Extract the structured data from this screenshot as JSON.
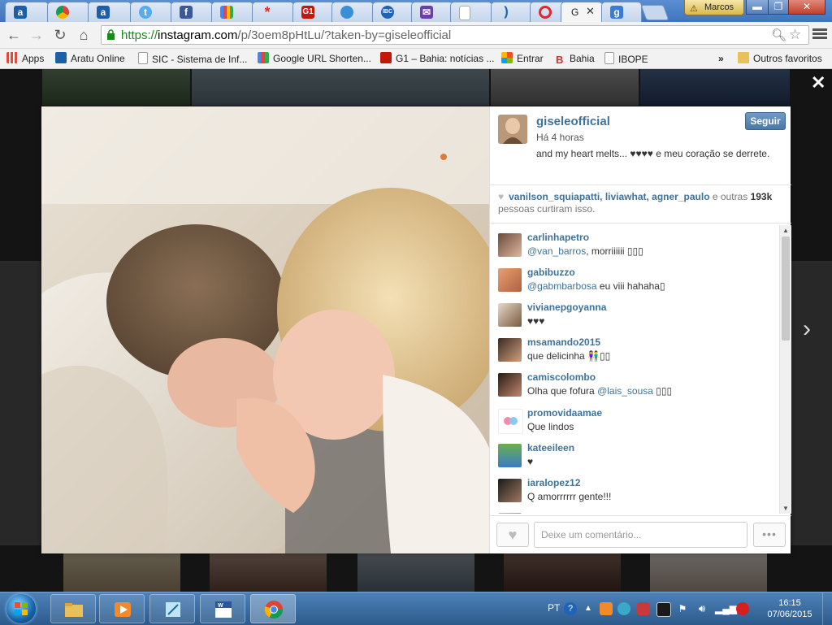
{
  "browser": {
    "active_tab_label": "G",
    "user_name": "Marcos",
    "url": {
      "scheme": "https://",
      "host": "instagram.com",
      "path": "/p/3oem8pHtLu/?taken-by=giseleofficial"
    }
  },
  "bookmarks": [
    {
      "label": "Apps",
      "icon": "apps-grid-icon",
      "color": "#e04c3c"
    },
    {
      "label": "Aratu Online",
      "icon": "aratu-icon",
      "color": "#1e5ea8"
    },
    {
      "label": "SIC - Sistema de Inf...",
      "icon": "page-icon",
      "color": "#ffffff"
    },
    {
      "label": "Google URL Shorten...",
      "icon": "google-icon",
      "color": "#3a7bd5"
    },
    {
      "label": "G1 – Bahia: notícias ...",
      "icon": "g1-icon",
      "color": "#c4170c"
    },
    {
      "label": "Entrar",
      "icon": "windows-logo-icon",
      "color": "#f25022"
    },
    {
      "label": "Bahia",
      "icon": "bahia-icon",
      "color": "#d32f2f"
    },
    {
      "label": "IBOPE",
      "icon": "page-icon",
      "color": "#ffffff"
    }
  ],
  "bookmarks_overflow": "»",
  "bookmarks_folder": "Outros favoritos",
  "post": {
    "username": "giseleofficial",
    "follow_label": "Seguir",
    "time": "Há 4 horas",
    "caption": "and my heart melts... ♥♥♥♥ e meu coração se derrete.",
    "likes_users": "vanilson_squiapatti, liviawhat, agner_paulo",
    "likes_others_prefix": "e outras",
    "likes_count": "193k",
    "likes_suffix": "pessoas curtiram isso."
  },
  "comments": [
    {
      "user": "carlinhapetro",
      "mention": "@van_barros",
      "text": ", morriiiiii ▯▯▯"
    },
    {
      "user": "gabibuzzo",
      "mention": "@gabmbarbosa",
      "text": " eu viii hahaha▯"
    },
    {
      "user": "vivianepgoyanna",
      "mention": "",
      "text": "♥♥♥"
    },
    {
      "user": "msamando2015",
      "mention": "",
      "text": "que delicinha 👫▯▯"
    },
    {
      "user": "camiscolombo",
      "mention": "@lais_sousa",
      "text": "Olha que fofura ",
      "after": " ▯▯▯"
    },
    {
      "user": "promovidaamae",
      "mention": "",
      "text": "Que lindos"
    },
    {
      "user": "kateeileen",
      "mention": "",
      "text": "♥"
    },
    {
      "user": "iaralopez12",
      "mention": "",
      "text": "Q amorrrrrr gente!!!"
    }
  ],
  "comment_input": {
    "placeholder": "Deixe um comentário..."
  },
  "more_label": "•••",
  "taskbar": {
    "lang": "PT",
    "time": "16:15",
    "date": "07/06/2015"
  }
}
